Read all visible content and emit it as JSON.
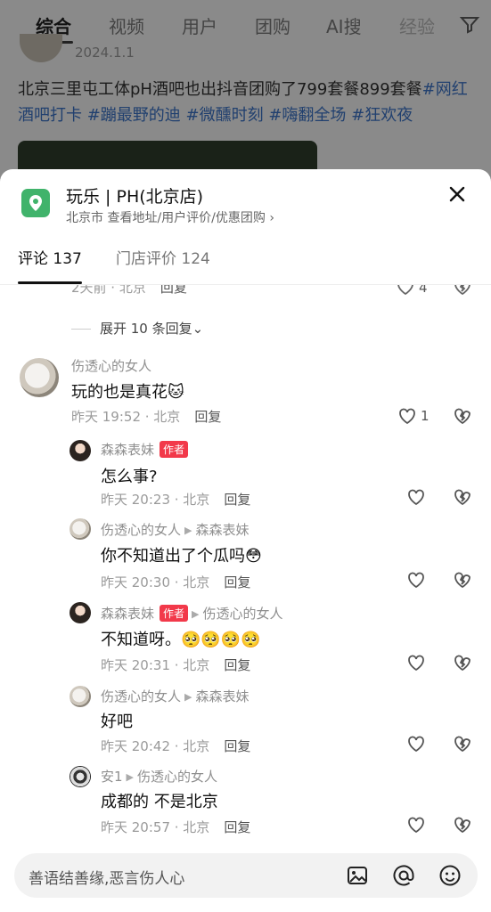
{
  "top_tabs": [
    "综合",
    "视频",
    "用户",
    "团购",
    "AI搜",
    "经验"
  ],
  "background_post": {
    "date": "2024.1.1",
    "text_plain": "北京三里屯工体pH酒吧也出抖音团购了799套餐899套餐",
    "text_tags": "#网红酒吧打卡 #蹦最野的迪 #微醺时刻 #嗨翻全场 #狂欢夜"
  },
  "sheet": {
    "title": "玩乐 | PH(北京店)",
    "subtitle": "北京市 查看地址/用户评价/优惠团购 ›",
    "tabs": [
      "评论 137",
      "门店评价 124"
    ],
    "partial_row": {
      "meta": "2天前 · 北京",
      "reply": "回复",
      "likes": "4"
    },
    "expand_label": "展开 10 条回复⌄",
    "comments": [
      {
        "name": "伤透心的女人",
        "text": "玩的也是真花🐱",
        "time": "昨天 19:52 · 北京",
        "reply": "回复",
        "likes": "1",
        "avatar": "cat"
      },
      {
        "name": "森森表妹",
        "badge": "作者",
        "text": "怎么事?",
        "time": "昨天 20:23 · 北京",
        "reply": "回复",
        "avatar": "girl"
      },
      {
        "name": "伤透心的女人",
        "reply_to": "森森表妹",
        "text": "你不知道出了个瓜吗😳",
        "time": "昨天 20:30 · 北京",
        "reply": "回复",
        "avatar": "cat"
      },
      {
        "name": "森森表妹",
        "badge": "作者",
        "reply_to": "伤透心的女人",
        "text": "不知道呀。🥺🥺🥺🥺",
        "time": "昨天 20:31 · 北京",
        "reply": "回复",
        "avatar": "girl"
      },
      {
        "name": "伤透心的女人",
        "reply_to": "森森表妹",
        "text": "好吧",
        "time": "昨天 20:42 · 北京",
        "reply": "回复",
        "avatar": "cat"
      },
      {
        "name": "安1",
        "reply_to": "伤透心的女人",
        "text": "成都的 不是北京",
        "time": "昨天 20:57 · 北京",
        "reply": "回复",
        "avatar": "bw"
      }
    ]
  },
  "input": {
    "placeholder": "善语结善缘,恶言伤人心"
  },
  "colors": {
    "accent_red": "#f2394a",
    "pin_green": "#40b36b"
  }
}
